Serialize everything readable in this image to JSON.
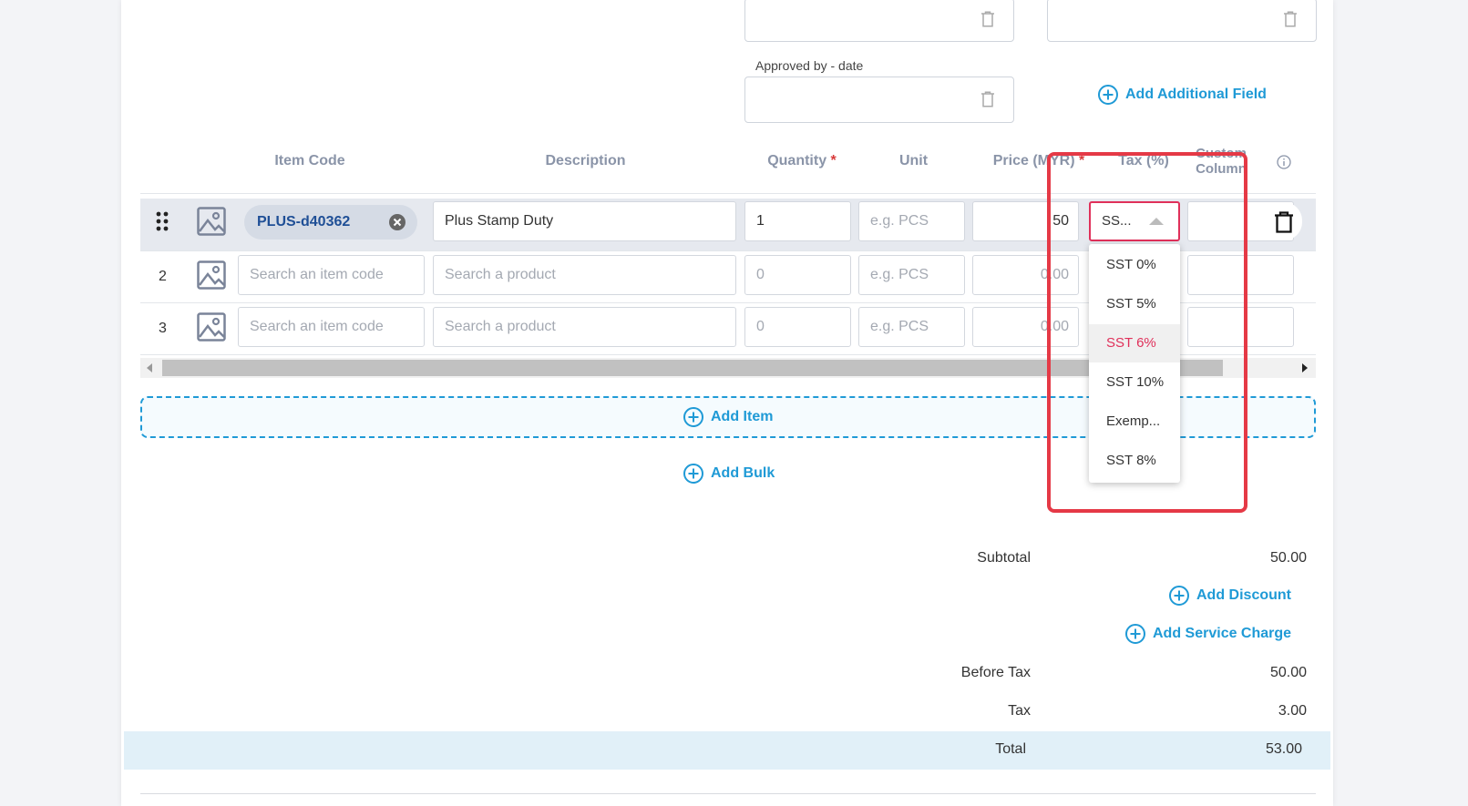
{
  "custom_fields": {
    "approved_by_date_label": "Approved by - date",
    "add_additional_field": "Add Additional Field"
  },
  "table": {
    "headers": {
      "item_code": "Item Code",
      "description": "Description",
      "quantity": "Quantity",
      "required_mark": "*",
      "unit": "Unit",
      "price": "Price (MYR)",
      "tax": "Tax (%)",
      "custom_column": "Custom Column"
    },
    "rows": [
      {
        "item_code_chip": "PLUS-d40362",
        "description": "Plus Stamp Duty",
        "quantity": "1",
        "unit_placeholder": "e.g. PCS",
        "price": "50",
        "tax": "SS..."
      },
      {
        "num": "2",
        "item_code_placeholder": "Search an item code",
        "description_placeholder": "Search a product",
        "quantity_placeholder": "0",
        "unit_placeholder": "e.g. PCS",
        "price_placeholder": "0.00"
      },
      {
        "num": "3",
        "item_code_placeholder": "Search an item code",
        "description_placeholder": "Search a product",
        "quantity_placeholder": "0",
        "unit_placeholder": "e.g. PCS",
        "price_placeholder": "0.00"
      }
    ]
  },
  "tax_dropdown": {
    "options": [
      "SST 0%",
      "SST 5%",
      "SST 6%",
      "SST 10%",
      "Exemp...",
      "SST 8%"
    ],
    "selected": "SST 6%"
  },
  "actions": {
    "add_item": "Add Item",
    "add_bulk": "Add Bulk",
    "add_discount": "Add Discount",
    "add_service_charge": "Add Service Charge"
  },
  "summary": {
    "subtotal_label": "Subtotal",
    "subtotal": "50.00",
    "before_tax_label": "Before Tax",
    "before_tax": "50.00",
    "tax_label": "Tax",
    "tax": "3.00",
    "total_label": "Total",
    "total": "53.00"
  },
  "colors": {
    "accent": "#1f9ad6",
    "highlight_box": "#e53946",
    "selected_option": "#e0305a",
    "total_row_bg": "#e1f0f8"
  }
}
